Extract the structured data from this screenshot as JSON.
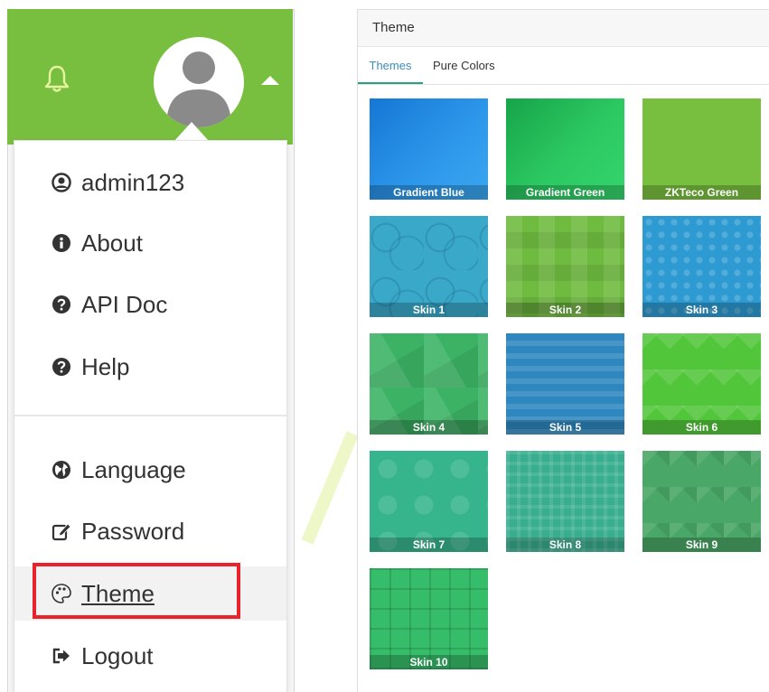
{
  "user_menu": {
    "username": "admin123",
    "items": [
      {
        "label": "About",
        "icon": "info-circle-icon"
      },
      {
        "label": "API Doc",
        "icon": "question-circle-icon"
      },
      {
        "label": "Help",
        "icon": "question-circle-icon"
      },
      {
        "label": "Language",
        "icon": "globe-icon"
      },
      {
        "label": "Password",
        "icon": "edit-icon"
      },
      {
        "label": "Theme",
        "icon": "palette-icon"
      },
      {
        "label": "Logout",
        "icon": "sign-out-icon"
      }
    ],
    "highlighted_item": "Theme"
  },
  "header": {
    "color": "#79bf3f",
    "icons": [
      "bell-icon",
      "avatar",
      "caret-up-icon"
    ]
  },
  "theme_panel": {
    "title": "Theme",
    "tabs": [
      {
        "label": "Themes",
        "active": true
      },
      {
        "label": "Pure Colors",
        "active": false
      }
    ],
    "swatches": [
      {
        "label": "Gradient Blue"
      },
      {
        "label": "Gradient Green"
      },
      {
        "label": "ZKTeco Green"
      },
      {
        "label": "Skin 1"
      },
      {
        "label": "Skin 2"
      },
      {
        "label": "Skin 3"
      },
      {
        "label": "Skin 4"
      },
      {
        "label": "Skin 5"
      },
      {
        "label": "Skin 6"
      },
      {
        "label": "Skin 7"
      },
      {
        "label": "Skin 8"
      },
      {
        "label": "Skin 9"
      },
      {
        "label": "Skin 10"
      }
    ]
  },
  "colors": {
    "accent": "#79bf3f",
    "highlight_border": "#e8232b",
    "active_tab_text": "#3c8dbc"
  }
}
